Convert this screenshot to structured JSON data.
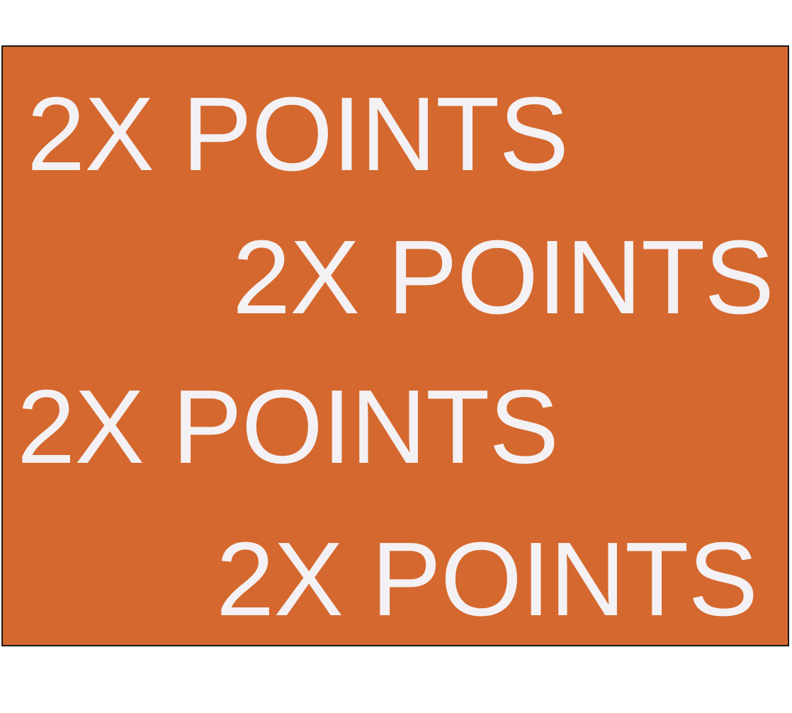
{
  "banner": {
    "background_color": "#d5682e",
    "text_color": "#f3f1f4",
    "border_color": "#1a1a1a",
    "lines": [
      "2X POINTS",
      "2X POINTS",
      "2X POINTS",
      "2X POINTS"
    ]
  }
}
